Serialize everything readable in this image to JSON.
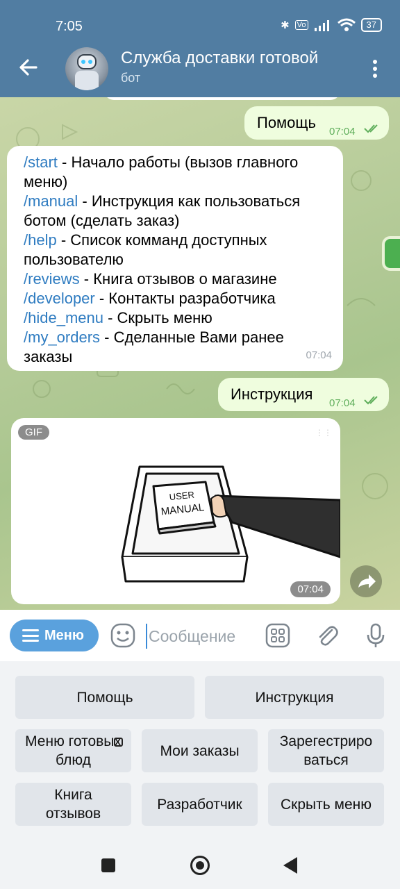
{
  "status_bar": {
    "time": "7:05",
    "battery": "37"
  },
  "header": {
    "title": "Служба доставки готовой",
    "subtitle": "бот"
  },
  "messages": {
    "help_out": {
      "text": "Помощь",
      "time": "07:04"
    },
    "commands": {
      "lines": [
        {
          "cmd": "/start",
          "desc": " - Начало работы (вызов главного меню)"
        },
        {
          "cmd": "/manual",
          "desc": " - Инструкция как пользоваться ботом (сделать заказ)"
        },
        {
          "cmd": "/help",
          "desc": " - Список комманд доступных пользователю"
        },
        {
          "cmd": "/reviews",
          "desc": " - Книга отзывов о магазине"
        },
        {
          "cmd": "/developer",
          "desc": " - Контакты разработчика"
        },
        {
          "cmd": "/hide_menu",
          "desc": " - Скрыть меню"
        },
        {
          "cmd": "/my_orders",
          "desc": " - Сделанные Вами ранее заказы"
        }
      ],
      "time": "07:04"
    },
    "manual_out": {
      "text": "Инструкция",
      "time": "07:04"
    },
    "gif": {
      "badge": "GIF",
      "image_text_1": "USER",
      "image_text_2": "MANUAL",
      "time": "07:04"
    }
  },
  "input_bar": {
    "menu_label": "Меню",
    "placeholder": "Сообщение"
  },
  "keyboard": {
    "row1": [
      "Помощь",
      "Инструкция"
    ],
    "row2": [
      "Меню готовых блюд",
      "Мои заказы",
      "Зарегестриро ваться"
    ],
    "row3": [
      "Книга отзывов",
      "Разработчик",
      "Скрыть меню"
    ]
  },
  "colors": {
    "header": "#517da2",
    "outgoing_bubble": "#effdde",
    "incoming_bubble": "#ffffff",
    "link": "#2f7cc1",
    "menu_button": "#5aa1dd"
  }
}
